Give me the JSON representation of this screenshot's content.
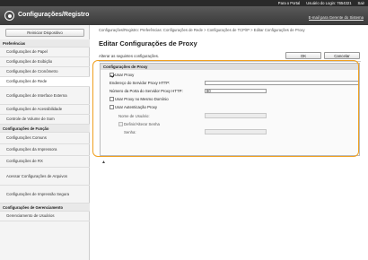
{
  "topbar": {
    "portal_link": "Para o Portal",
    "login_label": "Usuário do Login: 7654321",
    "logout_link": "Sair"
  },
  "header": {
    "app_title": "Configurações/Registro",
    "email_link": "E-mail para Gerente do Sistema"
  },
  "sidebar": {
    "restart_button": "Reiniciar Dispositivo",
    "sections": [
      {
        "title": "Preferências",
        "items": [
          {
            "label": "Configurações de Papel",
            "active": false
          },
          {
            "label": "Configurações de Exibição",
            "active": false
          },
          {
            "label": "Configurações de Cronômetro",
            "active": false
          },
          {
            "label": "Configurações de Rede",
            "active": true
          },
          {
            "label": "Configurações de Interface Externa",
            "active": false
          },
          {
            "label": "Configurações de Acessibilidade",
            "active": false
          },
          {
            "label": "Controle de Volume de Som",
            "active": false
          }
        ]
      },
      {
        "title": "Configurações de Função",
        "items": [
          {
            "label": "Configurações Comuns",
            "active": false
          },
          {
            "label": "Configurações da Impressora",
            "active": false
          },
          {
            "label": "Configurações de RX",
            "active": false
          },
          {
            "label": "Acessar Configurações de Arquivos",
            "active": false
          },
          {
            "label": "Configurações de Impressão Segura",
            "active": false
          }
        ]
      },
      {
        "title": "Configurações de Gerenciamento",
        "items": [
          {
            "label": "Gerenciamento de Usuários",
            "active": false
          }
        ]
      }
    ]
  },
  "main": {
    "breadcrumb": "Configurações/Registro: Preferências: Configurações de Rede > Configurações de TCP/IP > Editar Configurações de Proxy",
    "page_title": "Editar Configurações de Proxy",
    "instruction": "Alterar as seguintes configurações.",
    "ok_button": "OK",
    "cancel_button": "Cancelar",
    "panel": {
      "title": "Configurações de Proxy",
      "use_proxy_label": "Usar Proxy",
      "use_proxy_checked": true,
      "server_address_label": "Endereço do Servidor Proxy HTTP:",
      "server_address_value": "",
      "port_label": "Número da Porta do Servidor Proxy HTTP:",
      "port_value": "80",
      "same_domain_label": "Usar Proxy no Mesmo Domínio",
      "same_domain_checked": false,
      "auth_label": "Usar Autenticação Proxy",
      "auth_checked": false,
      "username_label": "Nome de Usuário:",
      "username_value": "",
      "set_password_label": "Definir/Alterar Senha",
      "set_password_checked": false,
      "password_label": "Senha:",
      "password_value": ""
    }
  },
  "footer": {
    "top_icon": "▲"
  }
}
